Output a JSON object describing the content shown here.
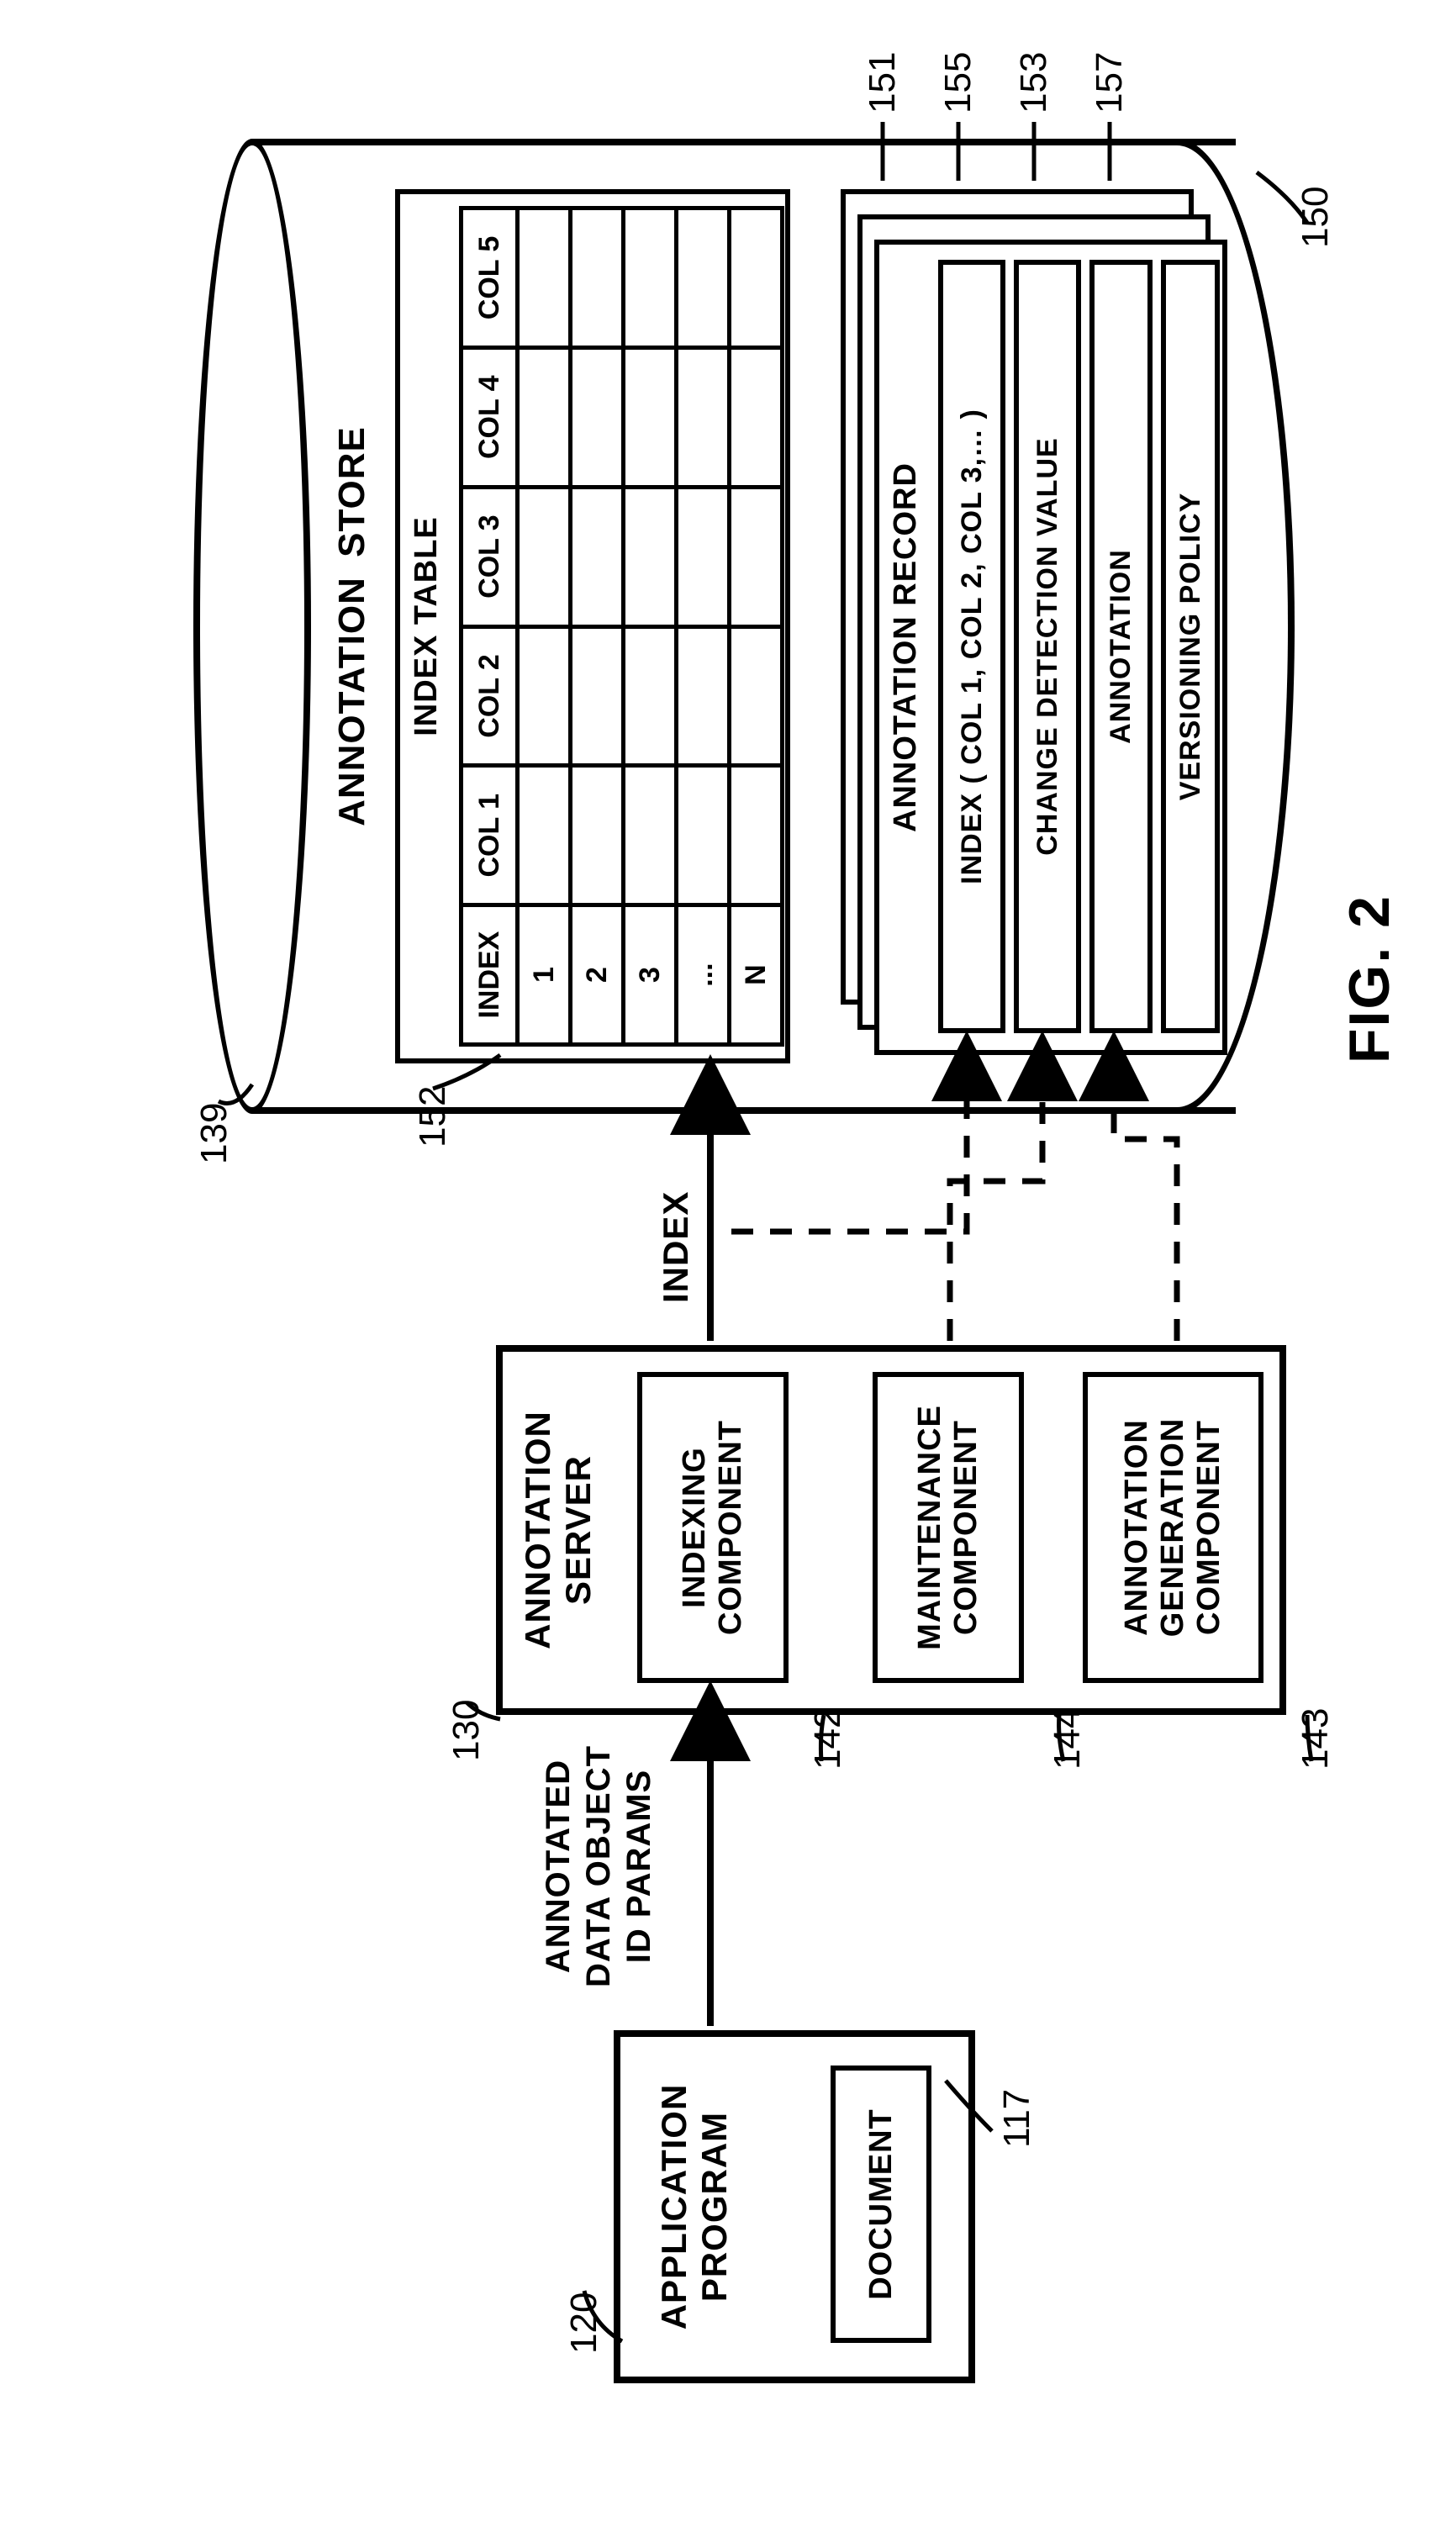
{
  "figure_label": "FIG. 2",
  "app_program": {
    "title": "APPLICATION PROGRAM",
    "document_label": "DOCUMENT",
    "ref_box": "120",
    "ref_doc": "117"
  },
  "arrow_app_to_server": {
    "line1": "ANNOTATED",
    "line2": "DATA OBJECT",
    "line3": "ID PARAMS"
  },
  "server": {
    "title": "ANNOTATION SERVER",
    "ref": "130",
    "indexing": {
      "label": "INDEXING COMPONENT",
      "ref": "142"
    },
    "maintenance": {
      "label": "MAINTENANCE COMPONENT",
      "ref": "144"
    },
    "generation": {
      "label": "ANNOTATION GENERATION COMPONENT",
      "ref": "143"
    }
  },
  "index_arrow_label": "INDEX",
  "store": {
    "title": "ANNOTATION      STORE",
    "ref_top": "139",
    "ref_bottom": "150",
    "index_table": {
      "title": "INDEX TABLE",
      "ref": "152",
      "headers": [
        "INDEX",
        "COL 1",
        "COL 2",
        "COL 3",
        "COL 4",
        "COL 5"
      ],
      "rows": [
        "1",
        "2",
        "3",
        "...",
        "N"
      ]
    },
    "record": {
      "title": "ANNOTATION RECORD",
      "rows": {
        "index": "INDEX ( COL 1, COL 2, COL 3,… )",
        "change": "CHANGE DETECTION VALUE",
        "annotation": "ANNOTATION",
        "versioning": "VERSIONING POLICY"
      },
      "refs": {
        "index": "151",
        "change": "155",
        "annotation": "153",
        "versioning": "157"
      }
    }
  }
}
